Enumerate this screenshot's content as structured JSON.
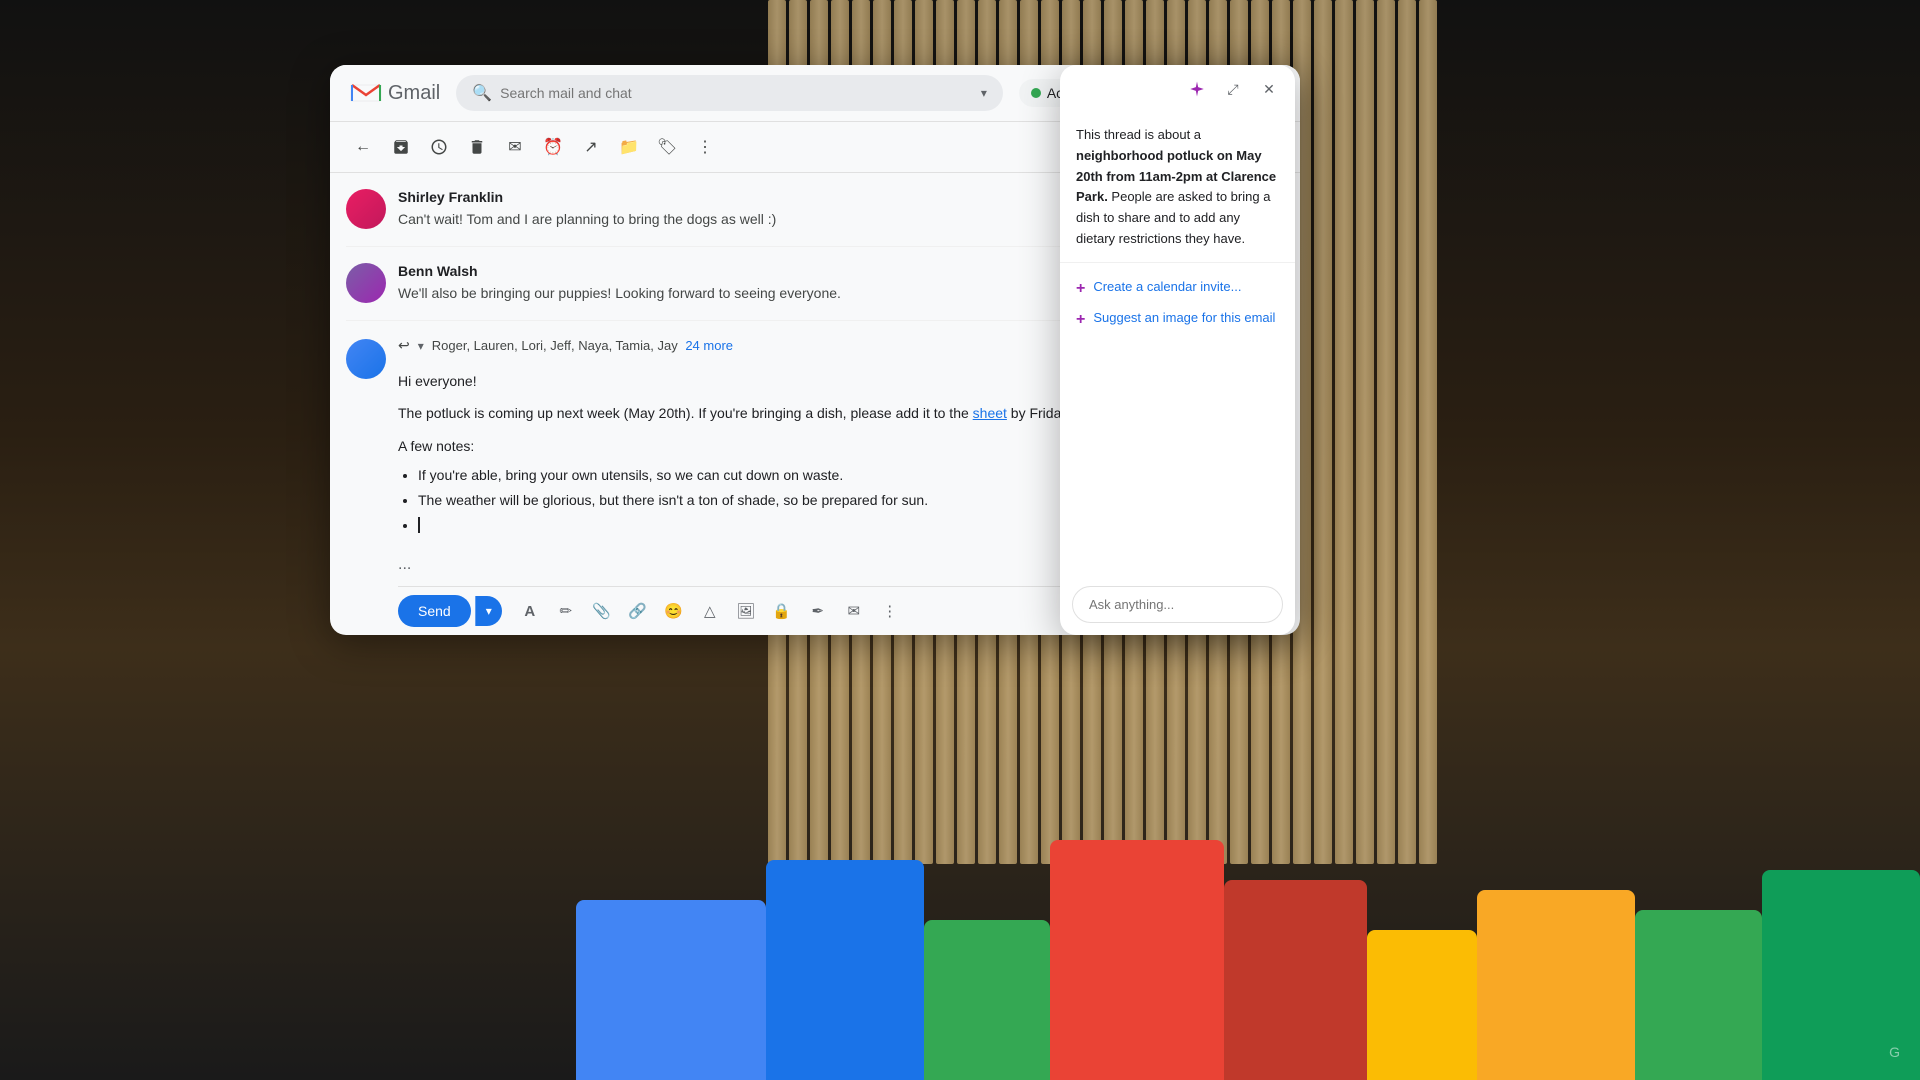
{
  "app": {
    "title": "Gmail",
    "search_placeholder": "Search mail and chat",
    "active_label": "Active"
  },
  "toolbar": {
    "back": "←",
    "archive": "archive",
    "snooze": "snooze",
    "delete": "delete",
    "mark": "mark",
    "clock": "clock",
    "forward": "forward",
    "folder": "folder",
    "label": "label",
    "more": "more"
  },
  "messages": [
    {
      "sender": "Shirley Franklin",
      "text": "Can't wait! Tom and I are planning to bring the dogs as well :)",
      "avatar_color": "#e91e63"
    },
    {
      "sender": "Benn Walsh",
      "text": "We'll also be bringing our puppies! Looking forward to seeing everyone.",
      "avatar_color": "#7b5ea7"
    }
  ],
  "compose": {
    "reply_icon": "↩",
    "recipients": "Roger, Lauren, Lori, Jeff, Naya, Tamia, Jay",
    "more_recipients": "24 more",
    "greeting": "Hi everyone!",
    "intro": "The potluck is coming up next week (May 20th). If you're bringing a dish, please add it to the",
    "link_text": "sheet",
    "intro_end": "by Friday!",
    "notes_header": "A few notes:",
    "bullets": [
      "If you're able, bring your own utensils, so we can cut down on waste.",
      "The weather will be glorious, but there isn't a ton of shade, so be prepared for sun.",
      ""
    ],
    "ellipsis": "...",
    "send_label": "Send"
  },
  "ai_panel": {
    "summary": "This thread is about a neighborhood potluck on May 20th from 11am-2pm at Clarence Park. People are asked to bring a dish to share and to add any dietary restrictions they have.",
    "actions": [
      "Create a calendar invite...",
      "Suggest an image for this email"
    ],
    "ask_placeholder": "Ask anything...",
    "gemini_icon": "✦"
  },
  "colors": {
    "gmail_blue": "#1a73e8",
    "active_green": "#34a853",
    "ai_purple": "#9c27b0"
  }
}
